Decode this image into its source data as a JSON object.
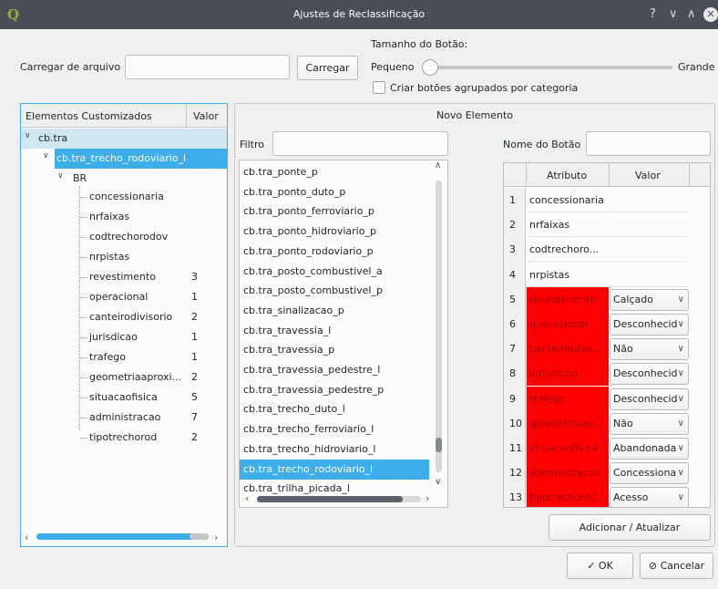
{
  "window": {
    "title": "Ajustes de Reclassificação",
    "icon_glyph": "Q",
    "help_glyph": "?",
    "minimize_glyph": "∨",
    "maximize_glyph": "∧",
    "close_glyph": "✕"
  },
  "top": {
    "load_file_label": "Carregar de arquivo",
    "load_file_value": "",
    "load_button": "Carregar",
    "button_size_label": "Tamanho do Botão:",
    "slider_min_label": "Pequeno",
    "slider_max_label": "Grande",
    "slider_value_fraction": 0.0,
    "group_checkbox_label": "Criar botões agrupados por categoria",
    "group_checkbox_checked": false
  },
  "tree": {
    "header_name": "Elementos Customizados",
    "header_value": "Valor",
    "root": "cb.tra",
    "layer": "cb.tra_trecho_rodoviario_l",
    "group": "BR",
    "items": [
      {
        "name": "concessionaria",
        "value": ""
      },
      {
        "name": "nrfaixas",
        "value": ""
      },
      {
        "name": "codtrechorodov",
        "value": ""
      },
      {
        "name": "nrpistas",
        "value": ""
      },
      {
        "name": "revestimento",
        "value": "3"
      },
      {
        "name": "operacional",
        "value": "1"
      },
      {
        "name": "canteirodivisorio",
        "value": "2"
      },
      {
        "name": "jurisdicao",
        "value": "1"
      },
      {
        "name": "trafego",
        "value": "1"
      },
      {
        "name": "geometriaaproxi...",
        "value": "2"
      },
      {
        "name": "situacaofisica",
        "value": "5"
      },
      {
        "name": "administracao",
        "value": "7"
      },
      {
        "name": "tipotrechorod",
        "value": "2"
      }
    ]
  },
  "new_element": {
    "title": "Novo Elemento",
    "filter_label": "Filtro",
    "filter_value": "",
    "button_name_label": "Nome do Botão",
    "button_name_value": "",
    "layers": [
      "cb.tra_ponte_p",
      "cb.tra_ponto_duto_p",
      "cb.tra_ponto_ferroviario_p",
      "cb.tra_ponto_hidroviario_p",
      "cb.tra_ponto_rodoviario_p",
      "cb.tra_posto_combustivel_a",
      "cb.tra_posto_combustivel_p",
      "cb.tra_sinalizacao_p",
      "cb.tra_travessia_l",
      "cb.tra_travessia_p",
      "cb.tra_travessia_pedestre_l",
      "cb.tra_travessia_pedestre_p",
      "cb.tra_trecho_duto_l",
      "cb.tra_trecho_ferroviario_l",
      "cb.tra_trecho_hidroviario_l",
      "cb.tra_trecho_rodoviario_l",
      "cb.tra_trilha_picada_l"
    ],
    "selected_layer": "cb.tra_trecho_rodoviario_l",
    "table": {
      "header_attr": "Atributo",
      "header_value": "Valor",
      "rows": [
        {
          "num": "1",
          "attr": "concessionaria",
          "value": "",
          "red": false
        },
        {
          "num": "2",
          "attr": "nrfaixas",
          "value": "",
          "red": false
        },
        {
          "num": "3",
          "attr": "codtrechoro...",
          "value": "",
          "red": false
        },
        {
          "num": "4",
          "attr": "nrpistas",
          "value": "",
          "red": false
        },
        {
          "num": "5",
          "attr": "revestimento",
          "value": "Calçado",
          "red": true
        },
        {
          "num": "6",
          "attr": "operacional",
          "value": "Desconhecid",
          "red": true
        },
        {
          "num": "7",
          "attr": "canteirodivis...",
          "value": "Não",
          "red": true
        },
        {
          "num": "8",
          "attr": "jurisdicao",
          "value": "Desconhecid",
          "red": true
        },
        {
          "num": "9",
          "attr": "trafego",
          "value": "Desconhecid",
          "red": true
        },
        {
          "num": "10",
          "attr": "geometriaap...",
          "value": "Não",
          "red": true
        },
        {
          "num": "11",
          "attr": "situacaofisica",
          "value": "Abandonada",
          "red": true
        },
        {
          "num": "12",
          "attr": "administracao",
          "value": "Concessiona",
          "red": true
        },
        {
          "num": "13",
          "attr": "tipotrechorod...",
          "value": "Acesso",
          "red": true
        }
      ]
    },
    "add_update_button": "Adicionar / Atualizar"
  },
  "footer": {
    "ok_icon": "✓",
    "ok_label": "OK",
    "cancel_icon": "⊘",
    "cancel_label": "Cancelar"
  },
  "colors": {
    "titlebar": "#475057",
    "selection": "#3daee9",
    "red_cell": "#ff0000",
    "window_bg": "#eff0f1"
  },
  "icons": [
    "qgis-logo-icon",
    "help-icon",
    "minimize-icon",
    "maximize-icon",
    "close-icon",
    "checkmark-icon",
    "cancel-icon",
    "chevron-down-icon",
    "tree-expand-icon"
  ]
}
